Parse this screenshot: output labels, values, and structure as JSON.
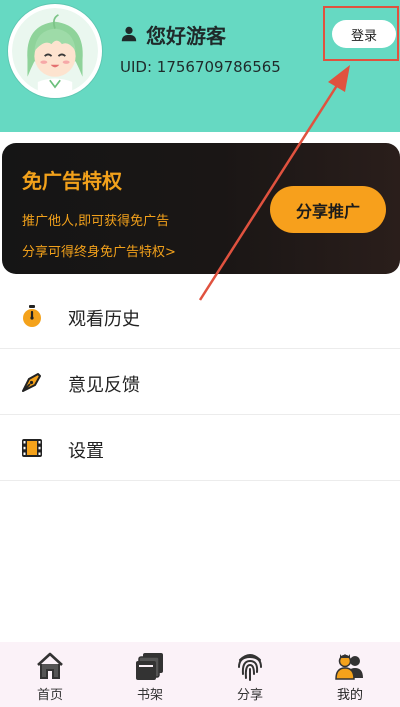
{
  "header": {
    "greeting": "您好游客",
    "uid": "UID: 1756709786565",
    "login_label": "登录"
  },
  "promo": {
    "title": "免广告特权",
    "line1": "推广他人,即可获得免广告",
    "line2": "分享可得终身免广告特权>",
    "share_button": "分享推广"
  },
  "menu": {
    "items": [
      {
        "label": "观看历史",
        "icon": "stopwatch-icon"
      },
      {
        "label": "意见反馈",
        "icon": "pen-nib-icon"
      },
      {
        "label": "设置",
        "icon": "film-icon"
      }
    ]
  },
  "tabs": [
    {
      "label": "首页",
      "icon": "home-icon"
    },
    {
      "label": "书架",
      "icon": "books-icon"
    },
    {
      "label": "分享",
      "icon": "fingerprint-icon"
    },
    {
      "label": "我的",
      "icon": "users-icon",
      "active": true
    }
  ],
  "colors": {
    "header_bg": "#66d9c2",
    "accent_orange": "#f7a01c",
    "promo_bg": "#151515",
    "annotation_red": "#e0523f",
    "tabbar_bg": "#fbf2f8"
  }
}
